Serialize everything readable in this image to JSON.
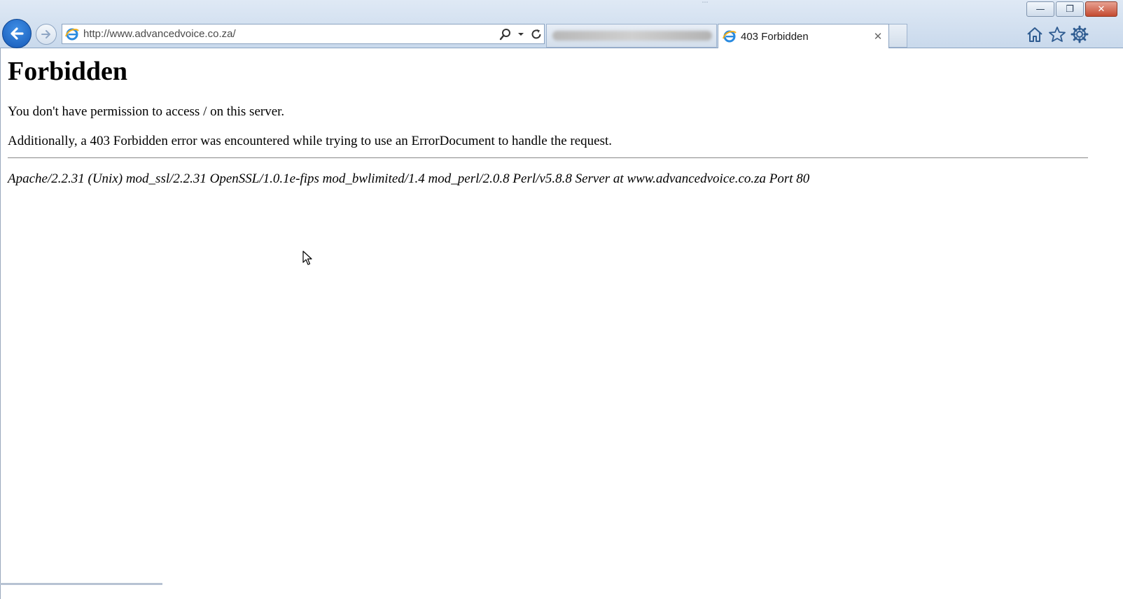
{
  "browser": {
    "address": {
      "url": "http://www.advancedvoice.co.za/"
    },
    "tabs": [
      {
        "title": "",
        "blurred": true
      },
      {
        "title": "403 Forbidden",
        "active": true,
        "close_glyph": "✕"
      }
    ],
    "window_buttons": {
      "minimize": "—",
      "restore": "❐",
      "close": "✕"
    },
    "icons": [
      "back-arrow-icon",
      "forward-arrow-icon",
      "ie-logo-icon",
      "search-icon",
      "dropdown-caret-icon",
      "refresh-icon",
      "home-icon",
      "favorites-star-icon",
      "settings-gear-icon"
    ]
  },
  "page": {
    "heading": "Forbidden",
    "message": "You don't have permission to access / on this server.",
    "additional": "Additionally, a 403 Forbidden error was encountered while trying to use an ErrorDocument to handle the request.",
    "server_signature": "Apache/2.2.31 (Unix) mod_ssl/2.2.31 OpenSSL/1.0.1e-fips mod_bwlimited/1.4 mod_perl/2.0.8 Perl/v5.8.8 Server at www.advancedvoice.co.za Port 80"
  },
  "colors": {
    "chrome_top": "#dfe9f5",
    "chrome_bottom": "#c9d9ec",
    "back_button": "#1f6fd0",
    "close_button": "#c44a30"
  }
}
